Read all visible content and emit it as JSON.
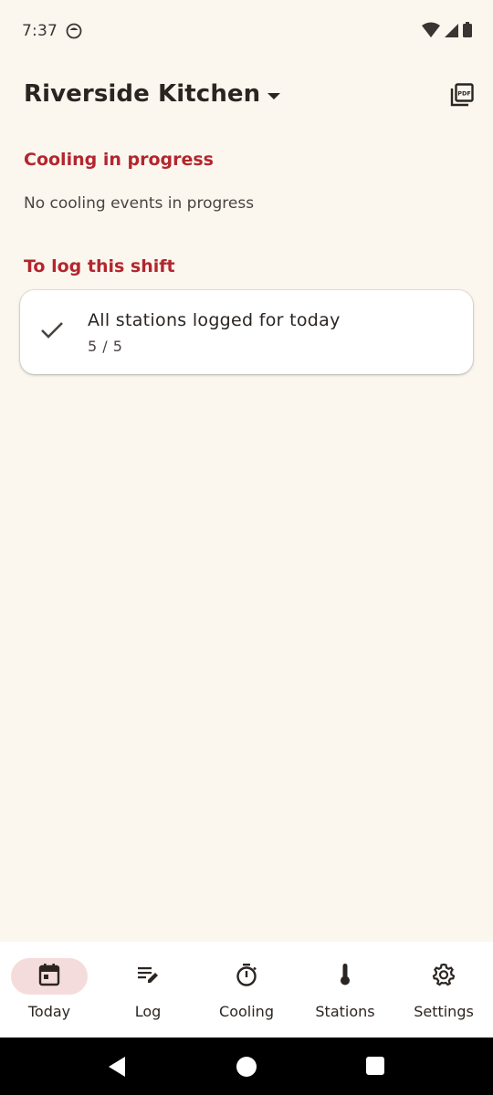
{
  "status_bar": {
    "time": "7:37",
    "icons": [
      "app-notification-icon",
      "wifi-icon",
      "cell-signal-icon",
      "battery-icon"
    ]
  },
  "app_bar": {
    "kitchen_name": "Riverside Kitchen",
    "dropdown_icon": "arrow-drop-down-icon",
    "export_icon": "picture-as-pdf-icon"
  },
  "cooling": {
    "heading": "Cooling in progress",
    "empty_text": "No cooling events in progress"
  },
  "to_log": {
    "heading": "To log this shift",
    "card": {
      "icon": "check-icon",
      "title": "All stations logged for today",
      "count": "5 / 5"
    }
  },
  "bottom_nav": {
    "items": [
      {
        "label": "Today",
        "icon": "calendar-icon",
        "active": true
      },
      {
        "label": "Log",
        "icon": "edit-note-icon",
        "active": false
      },
      {
        "label": "Cooling",
        "icon": "timer-icon",
        "active": false
      },
      {
        "label": "Stations",
        "icon": "thermometer-icon",
        "active": false
      },
      {
        "label": "Settings",
        "icon": "gear-icon",
        "active": false
      }
    ]
  },
  "colors": {
    "background": "#fbf7ef",
    "accent_red": "#b3262e",
    "active_pill": "#f5dcdc",
    "text_primary": "#2b2521"
  }
}
